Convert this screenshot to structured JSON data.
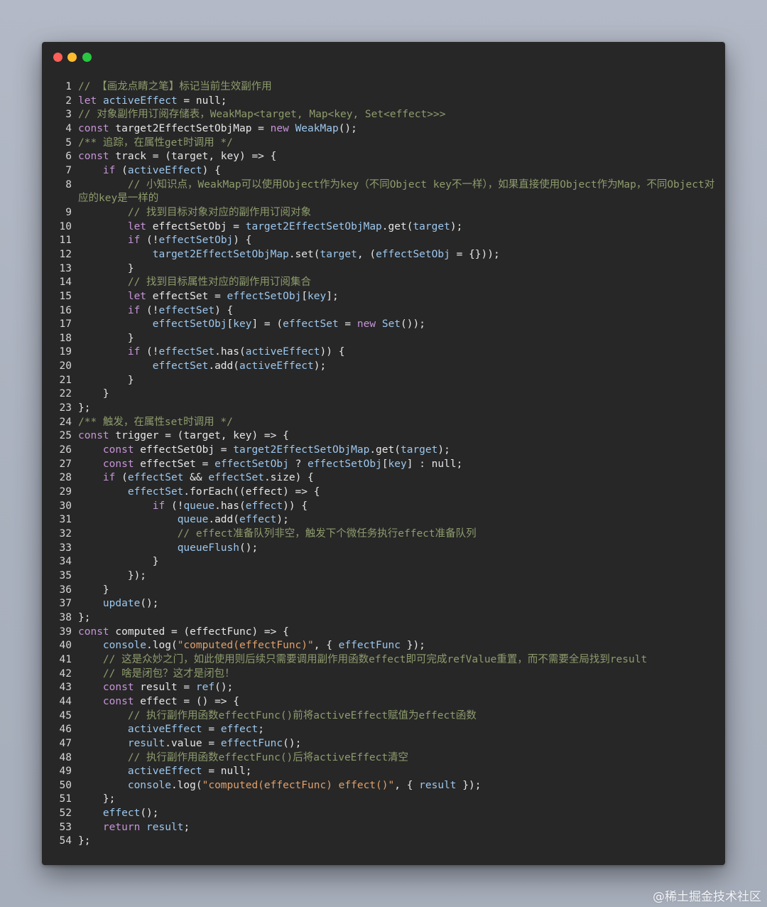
{
  "window": {
    "controls": [
      {
        "name": "close",
        "color": "#fe5f57"
      },
      {
        "name": "minimize",
        "color": "#febc2e"
      },
      {
        "name": "maximize",
        "color": "#28c840"
      }
    ]
  },
  "code_lines": [
    {
      "n": "1",
      "parts": [
        [
          "c",
          "// 【画龙点睛之笔】标记当前生效副作用"
        ]
      ]
    },
    {
      "n": "2",
      "parts": [
        [
          "k",
          "let"
        ],
        [
          "p",
          " "
        ],
        [
          "v",
          "activeEffect"
        ],
        [
          "p",
          " = null;"
        ]
      ]
    },
    {
      "n": "3",
      "parts": [
        [
          "c",
          "// 对象副作用订阅存储表，WeakMap<target, Map<key, Set<effect>>>"
        ]
      ]
    },
    {
      "n": "4",
      "parts": [
        [
          "k",
          "const"
        ],
        [
          "p",
          " target2EffectSetObjMap = "
        ],
        [
          "k",
          "new"
        ],
        [
          "p",
          " "
        ],
        [
          "v",
          "WeakMap"
        ],
        [
          "p",
          "();"
        ]
      ]
    },
    {
      "n": "5",
      "parts": [
        [
          "c",
          "/** 追踪，在属性get时调用 */"
        ]
      ]
    },
    {
      "n": "6",
      "parts": [
        [
          "k",
          "const"
        ],
        [
          "p",
          " track = (target, key) => {"
        ]
      ]
    },
    {
      "n": "7",
      "parts": [
        [
          "p",
          "    "
        ],
        [
          "k",
          "if"
        ],
        [
          "p",
          " ("
        ],
        [
          "v",
          "activeEffect"
        ],
        [
          "p",
          ") {"
        ]
      ]
    },
    {
      "n": "8",
      "parts": [
        [
          "p",
          "        "
        ],
        [
          "c",
          "// 小知识点，WeakMap可以使用Object作为key（不同Object key不一样），如果直接使用Object作为Map，不同Object对应的key是一样的"
        ]
      ]
    },
    {
      "n": "9",
      "parts": [
        [
          "p",
          "        "
        ],
        [
          "c",
          "// 找到目标对象对应的副作用订阅对象"
        ]
      ]
    },
    {
      "n": "10",
      "parts": [
        [
          "p",
          "        "
        ],
        [
          "k",
          "let"
        ],
        [
          "p",
          " effectSetObj = "
        ],
        [
          "v",
          "target2EffectSetObjMap"
        ],
        [
          "p",
          ".get("
        ],
        [
          "v",
          "target"
        ],
        [
          "p",
          ");"
        ]
      ]
    },
    {
      "n": "11",
      "parts": [
        [
          "p",
          "        "
        ],
        [
          "k",
          "if"
        ],
        [
          "p",
          " (!"
        ],
        [
          "v",
          "effectSetObj"
        ],
        [
          "p",
          ") {"
        ]
      ]
    },
    {
      "n": "12",
      "parts": [
        [
          "p",
          "            "
        ],
        [
          "v",
          "target2EffectSetObjMap"
        ],
        [
          "p",
          ".set("
        ],
        [
          "v",
          "target"
        ],
        [
          "p",
          ", ("
        ],
        [
          "v",
          "effectSetObj"
        ],
        [
          "p",
          " = {}));"
        ]
      ]
    },
    {
      "n": "13",
      "parts": [
        [
          "p",
          "        }"
        ]
      ]
    },
    {
      "n": "14",
      "parts": [
        [
          "p",
          "        "
        ],
        [
          "c",
          "// 找到目标属性对应的副作用订阅集合"
        ]
      ]
    },
    {
      "n": "15",
      "parts": [
        [
          "p",
          "        "
        ],
        [
          "k",
          "let"
        ],
        [
          "p",
          " effectSet = "
        ],
        [
          "v",
          "effectSetObj"
        ],
        [
          "p",
          "["
        ],
        [
          "v",
          "key"
        ],
        [
          "p",
          "];"
        ]
      ]
    },
    {
      "n": "16",
      "parts": [
        [
          "p",
          "        "
        ],
        [
          "k",
          "if"
        ],
        [
          "p",
          " (!"
        ],
        [
          "v",
          "effectSet"
        ],
        [
          "p",
          ") {"
        ]
      ]
    },
    {
      "n": "17",
      "parts": [
        [
          "p",
          "            "
        ],
        [
          "v",
          "effectSetObj"
        ],
        [
          "p",
          "["
        ],
        [
          "v",
          "key"
        ],
        [
          "p",
          "] = ("
        ],
        [
          "v",
          "effectSet"
        ],
        [
          "p",
          " = "
        ],
        [
          "k",
          "new"
        ],
        [
          "p",
          " "
        ],
        [
          "v",
          "Set"
        ],
        [
          "p",
          "());"
        ]
      ]
    },
    {
      "n": "18",
      "parts": [
        [
          "p",
          "        }"
        ]
      ]
    },
    {
      "n": "19",
      "parts": [
        [
          "p",
          "        "
        ],
        [
          "k",
          "if"
        ],
        [
          "p",
          " (!"
        ],
        [
          "v",
          "effectSet"
        ],
        [
          "p",
          ".has("
        ],
        [
          "v",
          "activeEffect"
        ],
        [
          "p",
          ")) {"
        ]
      ]
    },
    {
      "n": "20",
      "parts": [
        [
          "p",
          "            "
        ],
        [
          "v",
          "effectSet"
        ],
        [
          "p",
          ".add("
        ],
        [
          "v",
          "activeEffect"
        ],
        [
          "p",
          ");"
        ]
      ]
    },
    {
      "n": "21",
      "parts": [
        [
          "p",
          "        }"
        ]
      ]
    },
    {
      "n": "22",
      "parts": [
        [
          "p",
          "    }"
        ]
      ]
    },
    {
      "n": "23",
      "parts": [
        [
          "p",
          "};"
        ]
      ]
    },
    {
      "n": "24",
      "parts": [
        [
          "c",
          "/** 触发，在属性set时调用 */"
        ]
      ]
    },
    {
      "n": "25",
      "parts": [
        [
          "k",
          "const"
        ],
        [
          "p",
          " trigger = (target, key) => {"
        ]
      ]
    },
    {
      "n": "26",
      "parts": [
        [
          "p",
          "    "
        ],
        [
          "k",
          "const"
        ],
        [
          "p",
          " effectSetObj = "
        ],
        [
          "v",
          "target2EffectSetObjMap"
        ],
        [
          "p",
          ".get("
        ],
        [
          "v",
          "target"
        ],
        [
          "p",
          ");"
        ]
      ]
    },
    {
      "n": "27",
      "parts": [
        [
          "p",
          "    "
        ],
        [
          "k",
          "const"
        ],
        [
          "p",
          " effectSet = "
        ],
        [
          "v",
          "effectSetObj"
        ],
        [
          "p",
          " ? "
        ],
        [
          "v",
          "effectSetObj"
        ],
        [
          "p",
          "["
        ],
        [
          "v",
          "key"
        ],
        [
          "p",
          "] : null;"
        ]
      ]
    },
    {
      "n": "28",
      "parts": [
        [
          "p",
          "    "
        ],
        [
          "k",
          "if"
        ],
        [
          "p",
          " ("
        ],
        [
          "v",
          "effectSet"
        ],
        [
          "p",
          " && "
        ],
        [
          "v",
          "effectSet"
        ],
        [
          "p",
          ".size) {"
        ]
      ]
    },
    {
      "n": "29",
      "parts": [
        [
          "p",
          "        "
        ],
        [
          "v",
          "effectSet"
        ],
        [
          "p",
          ".forEach((effect) => {"
        ]
      ]
    },
    {
      "n": "30",
      "parts": [
        [
          "p",
          "            "
        ],
        [
          "k",
          "if"
        ],
        [
          "p",
          " (!"
        ],
        [
          "v",
          "queue"
        ],
        [
          "p",
          ".has("
        ],
        [
          "v",
          "effect"
        ],
        [
          "p",
          ")) {"
        ]
      ]
    },
    {
      "n": "31",
      "parts": [
        [
          "p",
          "                "
        ],
        [
          "v",
          "queue"
        ],
        [
          "p",
          ".add("
        ],
        [
          "v",
          "effect"
        ],
        [
          "p",
          ");"
        ]
      ]
    },
    {
      "n": "32",
      "parts": [
        [
          "p",
          "                "
        ],
        [
          "c",
          "// effect准备队列非空，触发下个微任务执行effect准备队列"
        ]
      ]
    },
    {
      "n": "33",
      "parts": [
        [
          "p",
          "                "
        ],
        [
          "v",
          "queueFlush"
        ],
        [
          "p",
          "();"
        ]
      ]
    },
    {
      "n": "34",
      "parts": [
        [
          "p",
          "            }"
        ]
      ]
    },
    {
      "n": "35",
      "parts": [
        [
          "p",
          "        });"
        ]
      ]
    },
    {
      "n": "36",
      "parts": [
        [
          "p",
          "    }"
        ]
      ]
    },
    {
      "n": "37",
      "parts": [
        [
          "p",
          "    "
        ],
        [
          "v",
          "update"
        ],
        [
          "p",
          "();"
        ]
      ]
    },
    {
      "n": "38",
      "parts": [
        [
          "p",
          "};"
        ]
      ]
    },
    {
      "n": "39",
      "parts": [
        [
          "k",
          "const"
        ],
        [
          "p",
          " computed = (effectFunc) => {"
        ]
      ]
    },
    {
      "n": "40",
      "parts": [
        [
          "p",
          "    "
        ],
        [
          "v",
          "console"
        ],
        [
          "p",
          ".log("
        ],
        [
          "s",
          "\"computed(effectFunc)\""
        ],
        [
          "p",
          ", { "
        ],
        [
          "v",
          "effectFunc"
        ],
        [
          "p",
          " });"
        ]
      ]
    },
    {
      "n": "41",
      "parts": [
        [
          "p",
          "    "
        ],
        [
          "c",
          "// 这是众妙之门，如此使用则后续只需要调用副作用函数effect即可完成refValue重置，而不需要全局找到result"
        ]
      ]
    },
    {
      "n": "42",
      "parts": [
        [
          "p",
          "    "
        ],
        [
          "c",
          "// 啥是闭包？这才是闭包！"
        ]
      ]
    },
    {
      "n": "43",
      "parts": [
        [
          "p",
          "    "
        ],
        [
          "k",
          "const"
        ],
        [
          "p",
          " result = "
        ],
        [
          "v",
          "ref"
        ],
        [
          "p",
          "();"
        ]
      ]
    },
    {
      "n": "44",
      "parts": [
        [
          "p",
          "    "
        ],
        [
          "k",
          "const"
        ],
        [
          "p",
          " effect = () => {"
        ]
      ]
    },
    {
      "n": "45",
      "parts": [
        [
          "p",
          "        "
        ],
        [
          "c",
          "// 执行副作用函数effectFunc()前将activeEffect赋值为effect函数"
        ]
      ]
    },
    {
      "n": "46",
      "parts": [
        [
          "p",
          "        "
        ],
        [
          "v",
          "activeEffect"
        ],
        [
          "p",
          " = "
        ],
        [
          "v",
          "effect"
        ],
        [
          "p",
          ";"
        ]
      ]
    },
    {
      "n": "47",
      "parts": [
        [
          "p",
          "        "
        ],
        [
          "v",
          "result"
        ],
        [
          "p",
          ".value = "
        ],
        [
          "v",
          "effectFunc"
        ],
        [
          "p",
          "();"
        ]
      ]
    },
    {
      "n": "48",
      "parts": [
        [
          "p",
          "        "
        ],
        [
          "c",
          "// 执行副作用函数effectFunc()后将activeEffect清空"
        ]
      ]
    },
    {
      "n": "49",
      "parts": [
        [
          "p",
          "        "
        ],
        [
          "v",
          "activeEffect"
        ],
        [
          "p",
          " = null;"
        ]
      ]
    },
    {
      "n": "50",
      "parts": [
        [
          "p",
          "        "
        ],
        [
          "v",
          "console"
        ],
        [
          "p",
          ".log("
        ],
        [
          "s",
          "\"computed(effectFunc) effect()\""
        ],
        [
          "p",
          ", { "
        ],
        [
          "v",
          "result"
        ],
        [
          "p",
          " });"
        ]
      ]
    },
    {
      "n": "51",
      "parts": [
        [
          "p",
          "    };"
        ]
      ]
    },
    {
      "n": "52",
      "parts": [
        [
          "p",
          "    "
        ],
        [
          "v",
          "effect"
        ],
        [
          "p",
          "();"
        ]
      ]
    },
    {
      "n": "53",
      "parts": [
        [
          "p",
          "    "
        ],
        [
          "k",
          "return"
        ],
        [
          "p",
          " "
        ],
        [
          "v",
          "result"
        ],
        [
          "p",
          ";"
        ]
      ]
    },
    {
      "n": "54",
      "parts": [
        [
          "p",
          "};"
        ]
      ]
    }
  ],
  "watermark": "@稀土掘金技术社区"
}
